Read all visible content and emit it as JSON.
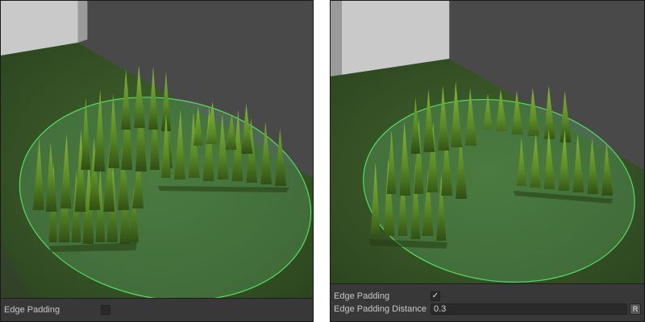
{
  "left_panel": {
    "edge_padding": {
      "label": "Edge Padding",
      "checked": false,
      "check_glyph": ""
    }
  },
  "right_panel": {
    "edge_padding": {
      "label": "Edge Padding",
      "checked": true,
      "check_glyph": "✓"
    },
    "edge_padding_distance": {
      "label": "Edge Padding Distance",
      "value": "0.3",
      "reset_label": "R"
    }
  },
  "colors": {
    "scene_background": "#4a4a4a",
    "ground": "#3d5a2a",
    "grass": "#6f9a2e",
    "circle_outline": "#4de05a",
    "circle_fill": "#58a35e",
    "inspector_background": "#383838"
  }
}
